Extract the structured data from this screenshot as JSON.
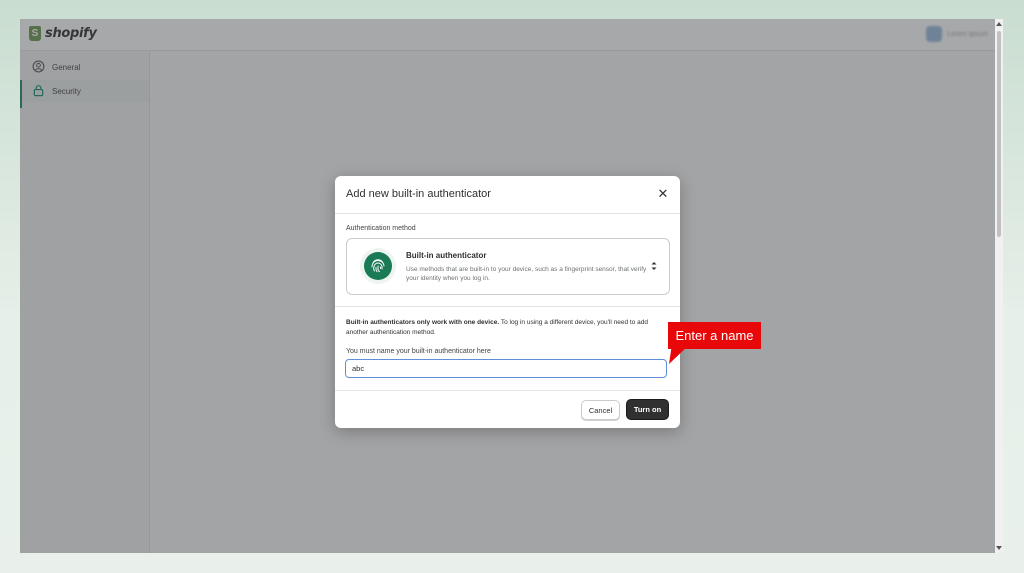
{
  "app": {
    "logo_text": "shopify",
    "user_name": "Lorem Ipsum"
  },
  "sidebar": {
    "items": [
      {
        "label": "General",
        "icon": "user-circle-icon",
        "active": false
      },
      {
        "label": "Security",
        "icon": "lock-icon",
        "active": true
      }
    ]
  },
  "modal": {
    "title": "Add new built-in authenticator",
    "close_icon": "close-icon",
    "method_label": "Authentication method",
    "method": {
      "title": "Built-in authenticator",
      "description": "Use methods that are built-in to your device, such as a fingerprint sensor, that verify your identity when you log in.",
      "icon": "fingerprint-icon"
    },
    "warning_bold": "Built-in authenticators only work with one device.",
    "warning_rest": " To log in using a different device, you'll need to add another authentication method.",
    "name_label": "You must name your built-in authenticator here",
    "name_value": "abc",
    "cancel_label": "Cancel",
    "turn_on_label": "Turn on"
  },
  "annotation": {
    "callout_text": "Enter a name",
    "color": "#e8080a"
  },
  "colors": {
    "brand_green": "#008060",
    "primary_button": "#303030",
    "input_focus": "#5f8fd8"
  }
}
